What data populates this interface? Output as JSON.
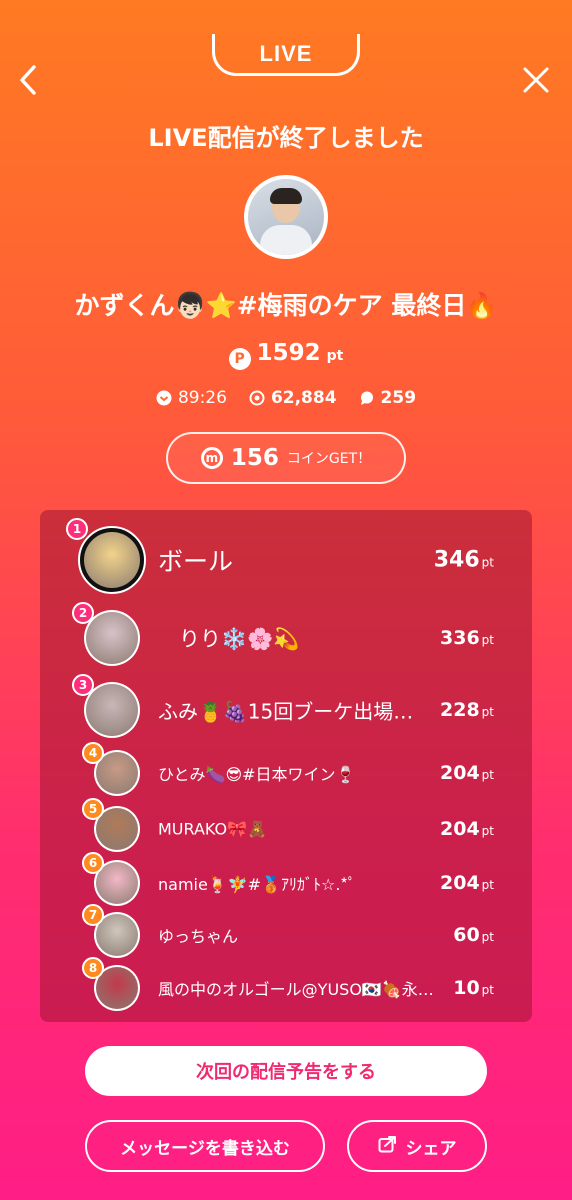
{
  "header": {
    "live_label": "LIVE",
    "back_icon": "chevron-left-icon",
    "close_icon": "close-icon"
  },
  "headline": "LIVE配信が終了しました",
  "stream": {
    "title": "かずくん👦🏻⭐#梅雨のケア 最終日🔥",
    "points_value": "1592",
    "points_unit": "pt",
    "points_icon_letter": "P"
  },
  "stats": {
    "duration": "89:26",
    "views": "62,884",
    "comments": "259"
  },
  "coins": {
    "value": "156",
    "label": "コインGET！",
    "icon_letter": "m"
  },
  "ranking": [
    {
      "rank": "1",
      "name": "ボール",
      "score": "346",
      "unit": "pt",
      "badge_color": "#ff2e7a",
      "avatar_color": "#f2d38a"
    },
    {
      "rank": "2",
      "name": "　りり❄️🌸💫",
      "score": "336",
      "unit": "pt",
      "badge_color": "#ff2e7a",
      "avatar_color": "#d8c2c8"
    },
    {
      "rank": "3",
      "name": "ふみ🍍🍇15回ブーケ出場…",
      "score": "228",
      "unit": "pt",
      "badge_color": "#ff2e7a",
      "avatar_color": "#c9b6b9"
    },
    {
      "rank": "4",
      "name": "ひとみ🍆😎#日本ワイン🍷",
      "score": "204",
      "unit": "pt",
      "badge_color": "#ff8a1e",
      "avatar_color": "#c89a86"
    },
    {
      "rank": "5",
      "name": "MURAKO🎀🧸",
      "score": "204",
      "unit": "pt",
      "badge_color": "#ff8a1e",
      "avatar_color": "#b07a5a"
    },
    {
      "rank": "6",
      "name": "namie🍹🧚#🥉ｱﾘｶﾞﾄ☆.*ﾟ",
      "score": "204",
      "unit": "pt",
      "badge_color": "#ff8a1e",
      "avatar_color": "#f2b8c6"
    },
    {
      "rank": "7",
      "name": "ゆっちゃん",
      "score": "60",
      "unit": "pt",
      "badge_color": "#ff8a1e",
      "avatar_color": "#cfc6bd"
    },
    {
      "rank": "8",
      "name": "風の中のオルゴール@YUSO🇰🇷🍖永…",
      "score": "10",
      "unit": "pt",
      "badge_color": "#ff8a1e",
      "avatar_color": "#c23a4a"
    }
  ],
  "actions": {
    "schedule_label": "次回の配信予告をする",
    "message_label": "メッセージを書き込む",
    "share_label": "シェア",
    "share_icon": "share-icon"
  }
}
